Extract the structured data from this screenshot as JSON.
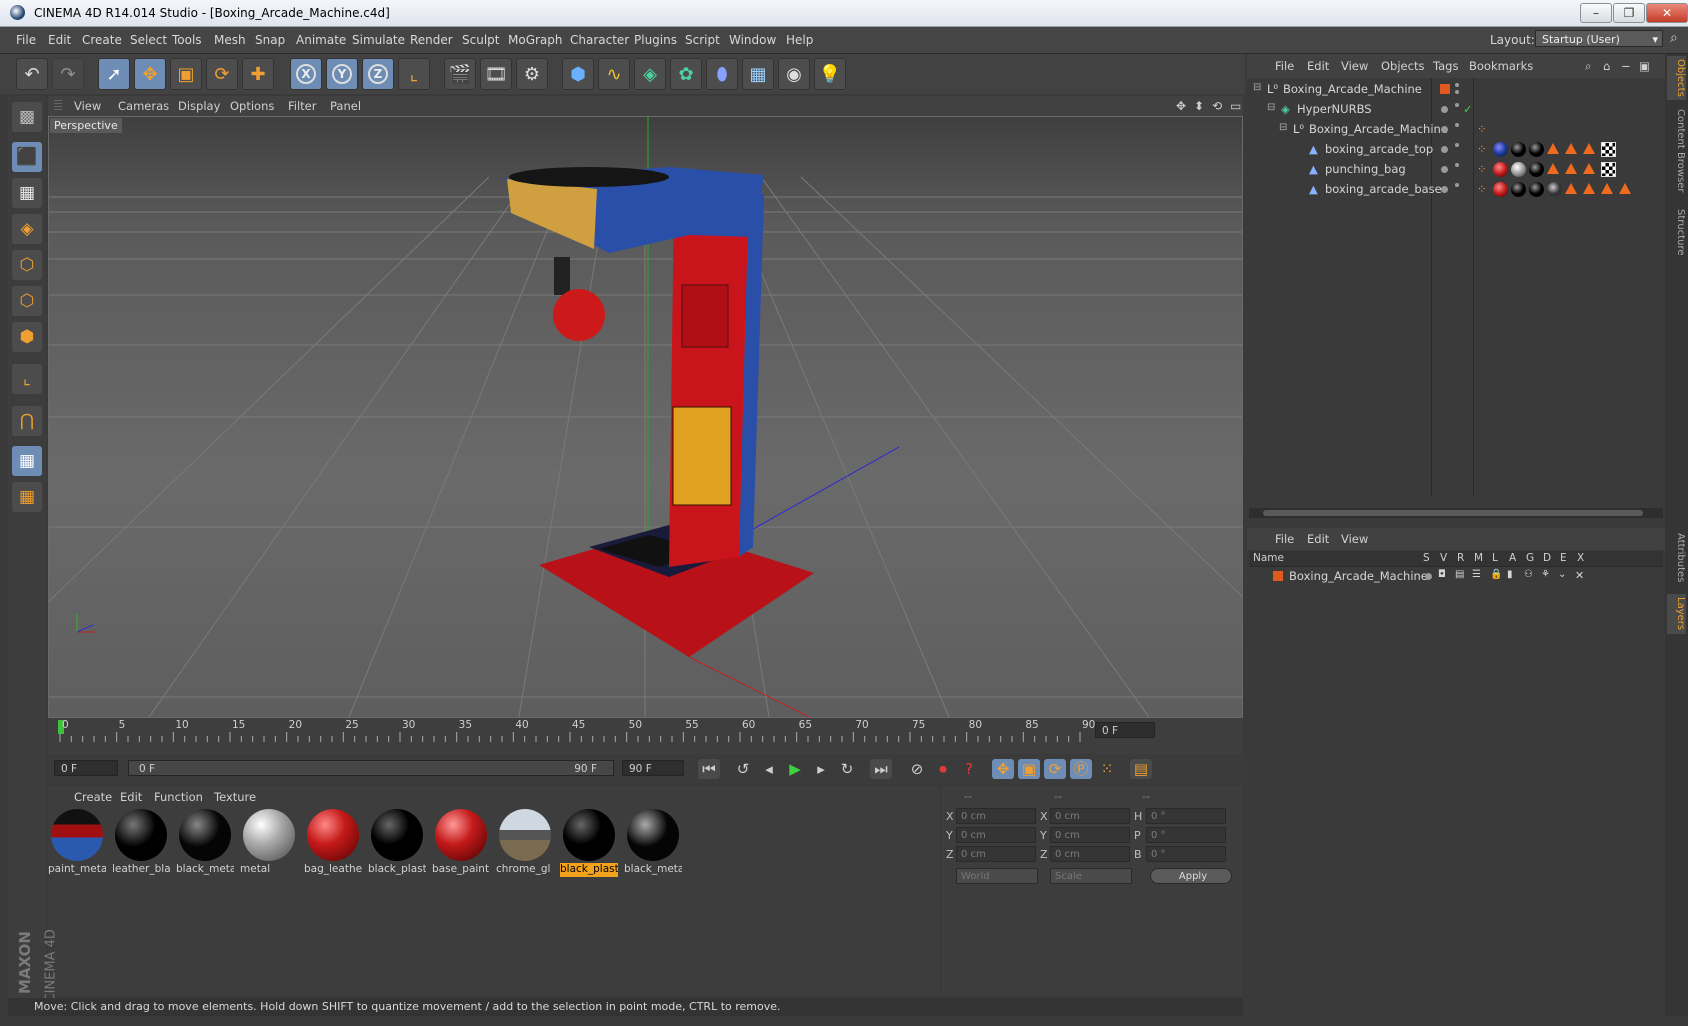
{
  "window": {
    "title": "CINEMA 4D R14.014 Studio - [Boxing_Arcade_Machine.c4d]",
    "min": "–",
    "max": "❐",
    "close": "✕"
  },
  "menubar": {
    "items": [
      "File",
      "Edit",
      "Create",
      "Select",
      "Tools",
      "Mesh",
      "Snap",
      "Animate",
      "Simulate",
      "Render",
      "Sculpt",
      "MoGraph",
      "Character",
      "Plugins",
      "Script",
      "Window",
      "Help"
    ],
    "layout_label": "Layout:",
    "layout_value": "Startup (User)"
  },
  "viewport": {
    "menu": [
      "View",
      "Cameras",
      "Display",
      "Options",
      "Filter",
      "Panel"
    ],
    "label": "Perspective"
  },
  "timeline": {
    "ticks": [
      "0",
      "5",
      "10",
      "15",
      "20",
      "25",
      "30",
      "35",
      "40",
      "45",
      "50",
      "55",
      "60",
      "65",
      "70",
      "75",
      "80",
      "85",
      "90"
    ],
    "frame_field": "0 F",
    "start_field": "0 F",
    "range_start": "0 F",
    "range_end": "90 F",
    "end_field": "90 F"
  },
  "materials": {
    "menu": [
      "Create",
      "Edit",
      "Function",
      "Texture"
    ],
    "items": [
      {
        "name": "paint_meta",
        "selected": false
      },
      {
        "name": "leather_bla",
        "selected": false
      },
      {
        "name": "black_meta",
        "selected": false
      },
      {
        "name": "metal",
        "selected": false
      },
      {
        "name": "bag_leathe",
        "selected": false
      },
      {
        "name": "black_plast",
        "selected": false
      },
      {
        "name": "base_paint",
        "selected": false
      },
      {
        "name": "chrome_gl",
        "selected": false
      },
      {
        "name": "black_plast",
        "selected": true
      },
      {
        "name": "black_meta",
        "selected": false
      }
    ]
  },
  "coords": {
    "headers": [
      "--",
      "--",
      "--"
    ],
    "rows": [
      {
        "a": "X",
        "av": "0 cm",
        "b": "X",
        "bv": "0 cm",
        "c": "H",
        "cv": "0 °"
      },
      {
        "a": "Y",
        "av": "0 cm",
        "b": "Y",
        "bv": "0 cm",
        "c": "P",
        "cv": "0 °"
      },
      {
        "a": "Z",
        "av": "0 cm",
        "b": "Z",
        "bv": "0 cm",
        "c": "B",
        "cv": "0 °"
      }
    ],
    "mode": "World",
    "size_mode": "Scale",
    "apply": "Apply"
  },
  "objects": {
    "menu": [
      "File",
      "Edit",
      "View",
      "Objects",
      "Tags",
      "Bookmarks"
    ],
    "tree": [
      {
        "name": "Boxing_Arcade_Machine"
      },
      {
        "name": "HyperNURBS"
      },
      {
        "name": "Boxing_Arcade_Machine"
      },
      {
        "name": "boxing_arcade_top"
      },
      {
        "name": "punching_bag"
      },
      {
        "name": "boxing_arcade_base"
      }
    ]
  },
  "layers": {
    "menu": [
      "File",
      "Edit",
      "View"
    ],
    "header": {
      "name": "Name",
      "cols": [
        "S",
        "V",
        "R",
        "M",
        "L",
        "A",
        "G",
        "D",
        "E",
        "X"
      ]
    },
    "rows": [
      {
        "name": "Boxing_Arcade_Machine"
      }
    ]
  },
  "side_tabs": [
    "Objects",
    "Content Browser",
    "Structure",
    "Attributes",
    "Layers"
  ],
  "status": "Move: Click and drag to move elements. Hold down SHIFT to quantize movement / add to the selection in point mode, CTRL to remove.",
  "brand": {
    "line1": "MAXON",
    "line2": "CINEMA 4D"
  },
  "colors": {
    "accent": "#f2a21b",
    "selection": "#6e8db4",
    "machine_red": "#c8141a",
    "machine_blue": "#2a4fa8"
  }
}
